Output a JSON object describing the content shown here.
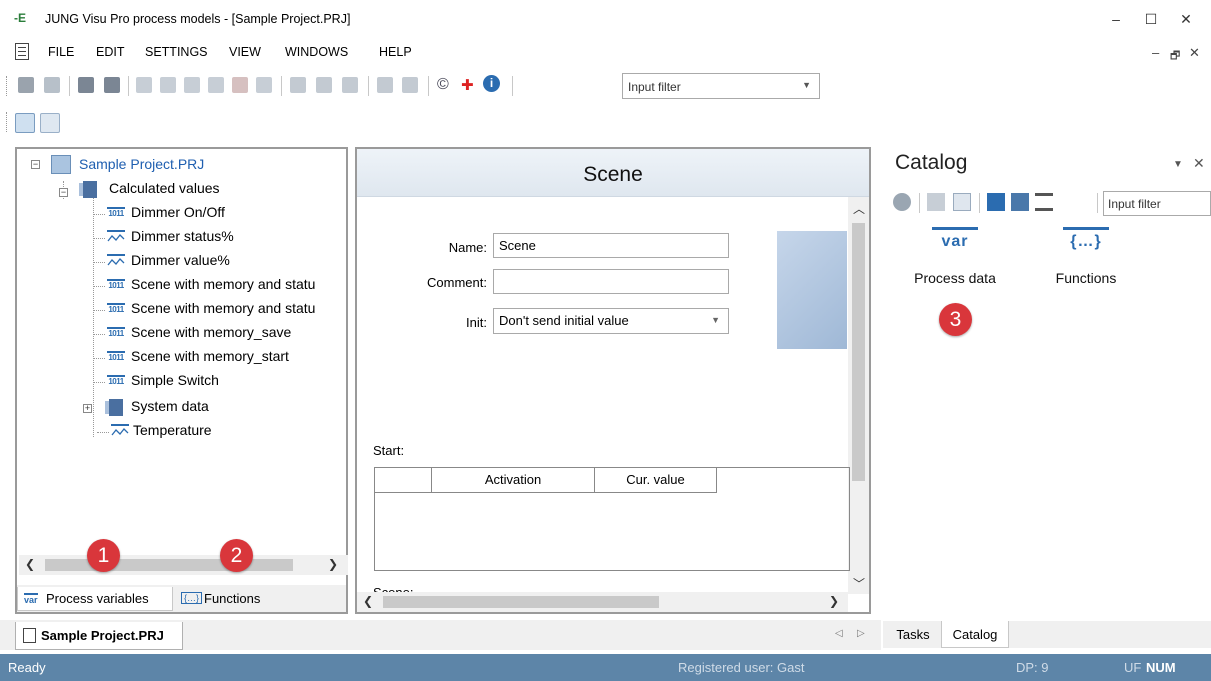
{
  "window": {
    "title": "JUNG Visu Pro process models - [Sample Project.PRJ]",
    "app_icon_glyph": "-E",
    "minimize": "–",
    "maximize": "☐",
    "close": "✕",
    "mdi_minimize": "–",
    "mdi_restore": "🗗",
    "mdi_close": "✕"
  },
  "menu": [
    "FILE",
    "EDIT",
    "SETTINGS",
    "VIEW",
    "WINDOWS",
    "HELP"
  ],
  "toolbar": {
    "input_filter_placeholder": "Input filter",
    "copyright_icon": "©",
    "plus_icon": "✚",
    "info_icon": "i"
  },
  "tree": {
    "root": "Sample Project.PRJ",
    "folder": "Calculated values",
    "items": [
      {
        "label": "Dimmer On/Off",
        "icon": "1011-icon"
      },
      {
        "label": "Dimmer status%",
        "icon": "wave-icon"
      },
      {
        "label": "Dimmer value%",
        "icon": "wave-icon"
      },
      {
        "label": "Scene with memory and statu",
        "icon": "1011-icon"
      },
      {
        "label": "Scene with memory and statu",
        "icon": "1011-icon"
      },
      {
        "label": "Scene with memory_save",
        "icon": "1011-icon"
      },
      {
        "label": "Scene with memory_start",
        "icon": "1011-icon"
      },
      {
        "label": "Simple Switch",
        "icon": "1011-icon"
      }
    ],
    "system_data": "System data",
    "temperature": "Temperature",
    "icon_1011_text": "1011"
  },
  "left_tabs": {
    "process_variables": "Process variables",
    "functions": "Functions",
    "var_icon_text": "var",
    "func_icon_text": "{…}"
  },
  "scene": {
    "header": "Scene",
    "name_label": "Name:",
    "name_value": "Scene",
    "comment_label": "Comment:",
    "comment_value": "",
    "init_label": "Init:",
    "init_value": "Don't send initial value",
    "start_label": "Start:",
    "col_activation": "Activation",
    "col_cur_value": "Cur. value",
    "scene_label": "Scene:"
  },
  "catalog": {
    "title": "Catalog",
    "filter_placeholder": "Input filter",
    "items": [
      {
        "label": "Process data",
        "icon_text": "var"
      },
      {
        "label": "Functions",
        "icon_text": "{…}"
      }
    ],
    "tab_tasks": "Tasks",
    "tab_catalog": "Catalog"
  },
  "badges": [
    "1",
    "2",
    "3"
  ],
  "doc_tab": "Sample Project.PRJ",
  "status": {
    "left": "Ready",
    "user": "Registered user: Gast",
    "dp": "DP: 9",
    "uf": "UF",
    "num": "NUM"
  },
  "colors": {
    "status_bar": "#5d85a8",
    "badge_red": "#d9363b",
    "icon_blue": "#2b6cb0",
    "link_blue": "#1f5fb0"
  }
}
